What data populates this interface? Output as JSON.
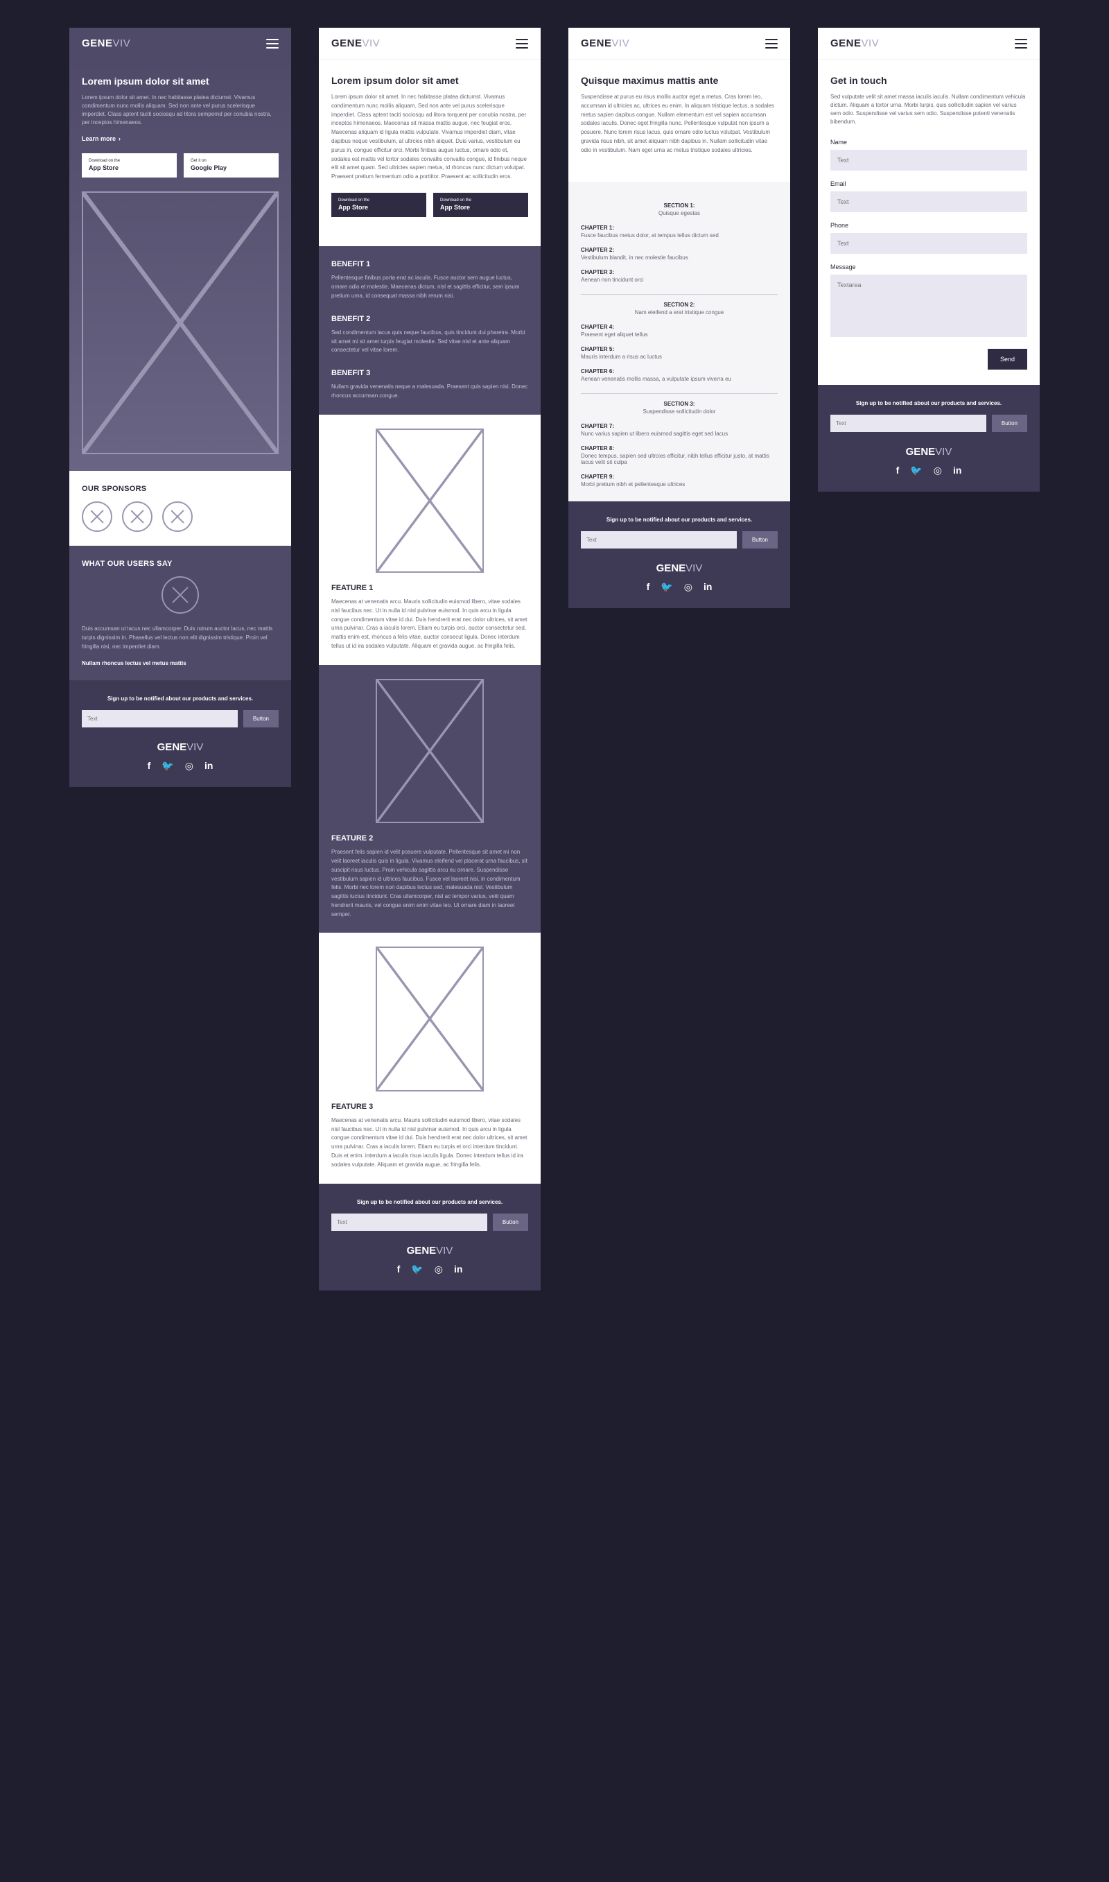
{
  "brand": {
    "a": "GENE",
    "b": "VIV"
  },
  "common": {
    "learnmore": "Learn more",
    "footer_note": "Sign up to be notified about our products and services.",
    "sub_placeholder": "Text",
    "sub_button": "Button"
  },
  "store": {
    "appstore_sm": "Download on the",
    "appstore_lg": "App Store",
    "google_sm": "Get it on",
    "google_lg": "Google Play"
  },
  "social": [
    "facebook",
    "twitter",
    "instagram",
    "linkedin"
  ],
  "screen1": {
    "hero_title": "Lorem ipsum dolor sit amet",
    "hero_body": "Lorem ipsum dolor sit amet. In nec habitasse platea dictumst. Vivamus condimentum nunc mollis aliquam. Sed non ante vel purus scelerisque imperdiet. Class aptent taciti sociosqu ad litora sempernd per conubia nostra, per inceptos himenaeos.",
    "sponsors_title": "OUR SPONSORS",
    "users_title": "WHAT OUR USERS SAY",
    "testimonial": "Duis accumsan ut lacus nec ullamcorper. Duis rutrum auctor lacus, nec mattis turpis dignissim in. Phasellus vel lectus non elit dignissim tristique. Proin vel fringilla nisi, nec imperdiet diam.",
    "testimonial_name": "Nullam rhoncus lectus vel metus mattis"
  },
  "screen2": {
    "title": "Lorem ipsum dolor sit amet",
    "body": "Lorem ipsum dolor sit amet. In nec habitasse platea dictumst. Vivamus condimentum nunc mollis aliquam. Sed non ante vel purus scelerisque imperdiet. Class aptent taciti sociosqu ad litora torquent per conubia nostra, per inceptos himenaeos. Maecenas sit massa mattis augue, nec feugiat eros. Maecenas aliquam id ligula mattis vulputate. Vivamus imperdiet diam, vitae dapibus neque vestibulum, at ultrcies nibh aliquet. Duis varius, vestibulum eu purus in, congue efficitur orci. Morbi finibus augue luctus, ornare odio et, sodales est mattis vel tortor sodales convallis convallis congue, id finibus neque elit sit amet quam. Sed ultricies sapien metus, id rhoncus nunc dictum volutpat. Praesent pretium fermentum odio a porttitor. Praesent ac sollicitudin eros.",
    "benefits": [
      {
        "title": "BENEFIT 1",
        "body": "Pellentesque finibus porta erat ac iaculis. Fusce auctor sem augue luctus, ornare odio et molestie. Maecenas dictum, nisl et sagittis efficitur, sem ipsum pretium urna, id consequat massa nibh rerum nisi."
      },
      {
        "title": "BENEFIT 2",
        "body": "Sed condimentum lacus quis neque faucibus, quis tincidunt dui pharetra. Morbi sit amet mi sit amet turpis feugiat molestie. Sed vitae nisl et ante aliquam consectetur vel vitae lorem."
      },
      {
        "title": "BENEFIT 3",
        "body": "Nullam gravida venenatis neque a malesuada. Praesent quis sapien nisi. Donec rhoncus accumsan congue."
      }
    ],
    "features": [
      {
        "title": "FEATURE 1",
        "body": "Maecenas at venenatis arcu. Mauris sollicitudin euismod libero, vitae sodales nisl faucibus nec. Ut in nulla id nisl pulvinar euismod. In quis arcu in ligula congue condimentum vitae id dui. Duis hendrerit erat nec dolor ultrices, sit amet urna pulvinar. Cras a iaculis lorem. Etiam eu turpis orci, auctor consectetur sed, mattis enim est, rhoncus a felis vitae, auctor consecut ligula. Donec interdum tellus ut id ira sodales vulputate. Aliquam et gravida augue, ac fringilla felis."
      },
      {
        "title": "FEATURE 2",
        "body": "Praesent felis sapien id velit posuere vulputate. Pellentesque sit amet mi non velit laoreet iaculis quis in ligula. Vivamus eleifend vel placerat urna faucibus, sit suscipit risus luctus. Proin vehicula sagittis arcu eu ornare. Suspendisse vestibulum sapien id ultrices faucibus. Fusce vel laoreet nisi, in condimentum felis. Morbi nec lorem non dapibus lectus sed, malesuada nisl. Vestibulum sagittis luctus tincidunt. Cras ullamcorper, nisl ac tempor varius, velit quam hendrerit mauris, vel congue enim enim vitae leo. Ut ornare diam in laoreet semper."
      },
      {
        "title": "FEATURE 3",
        "body": "Maecenas at venenatis arcu. Mauris sollicitudin euismod libero, vitae sodales nisl faucibus nec. Ut in nulla id nisl pulvinar euismod. In quis arcu in ligula congue condimentum vitae id dui. Duis hendrerit erat nec dolor ultrices, sit amet urna pulvinar. Cras a iaculis lorem. Etiam eu turpis et orci interdum tincidunt. Duis et enim. interdum a iaculis risus iaculis ligula. Donec interdum tellus id ira sodales vulputate. Aliquam et gravida augue, ac fringilla felis."
      }
    ]
  },
  "screen3": {
    "title": "Quisque maximus mattis ante",
    "body": "Suspendisse at purus eu risus mollis auctor eget a metus. Cras lorem leo, accumsan id ultricies ac, ultrices eu enim. In aliquam tristique lectus, a sodales metus sapien dapibus congue. Nullam elementum est vel sapien accumsan sodales iaculis. Donec eget fringilla nunc. Pellentesque vulputat non ipsum a posuere. Nunc lorem risus lacus, quis ornare odio luctus volutpat. Vestibulum gravida risus nibh, sit amet aliquam nibh dapibus in. Nullam sollicitudin vitae odio in vestibulum. Nam eget urna ac metus tristique sodales ultricies.",
    "sections": [
      {
        "label": "SECTION 1:",
        "sub": "Quisque egestas",
        "chapters": [
          {
            "label": "CHAPTER 1:",
            "desc": "Fusce faucibus metus dolor, at tempus tellus dictum sed"
          },
          {
            "label": "CHAPTER 2:",
            "desc": "Vestibulum blandit, in nec molestie faucibus"
          },
          {
            "label": "CHAPTER 3:",
            "desc": "Aenean non tincidunt orci"
          }
        ]
      },
      {
        "label": "SECTION 2:",
        "sub": "Nam eleifend a erat tristique congue",
        "chapters": [
          {
            "label": "CHAPTER 4:",
            "desc": "Praesent eget aliquet tellus"
          },
          {
            "label": "CHAPTER 5:",
            "desc": "Mauris interdum a risus ac luctus"
          },
          {
            "label": "CHAPTER 6:",
            "desc": "Aenean venenatis mollis massa, a vulputate ipsum viverra eu"
          }
        ]
      },
      {
        "label": "SECTION 3:",
        "sub": "Suspendisse sollicitudin dolor",
        "chapters": [
          {
            "label": "CHAPTER 7:",
            "desc": "Nunc varius sapien ut libero euismod sagittis eget sed lacus"
          },
          {
            "label": "CHAPTER 8:",
            "desc": "Donec tempus, sapien sed ultrcies efficitur, nibh tellus efficitur justo, at mattis lacus velit sit culpa"
          },
          {
            "label": "CHAPTER 9:",
            "desc": "Morbi pretium nibh et pellentesque ultrices"
          }
        ]
      }
    ]
  },
  "screen4": {
    "title": "Get in touch",
    "body": "Sed vulputate velit sit amet massa iaculis iaculis. Nullam condimentum vehicula dictum. Aliquam a tortor urna. Morbi turpis, quis sollicitudin sapien vel varius sem odio. Suspendisse vel varius sem odio. Suspendisse potenti venenatis bibendum.",
    "fields": [
      {
        "label": "Name",
        "placeholder": "Text"
      },
      {
        "label": "Email",
        "placeholder": "Text"
      },
      {
        "label": "Phone",
        "placeholder": "Text"
      }
    ],
    "message_label": "Message",
    "message_placeholder": "Textarea",
    "send": "Send"
  }
}
